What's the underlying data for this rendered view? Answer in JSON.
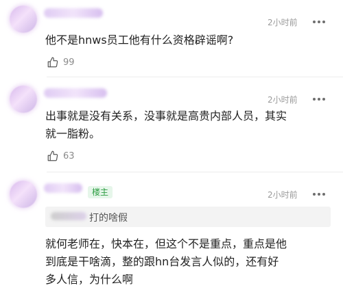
{
  "comments": [
    {
      "time": "2小时前",
      "text": "他不是hnws员工他有什么资格辟谣啊?",
      "likes": "99"
    },
    {
      "time": "2小时前",
      "text_line1": "出事就是没有关系，没事就是高贵内部人员，其实",
      "text_line2": "就一脂粉。",
      "likes": "63"
    },
    {
      "time": "2小时前",
      "badge": "楼主",
      "quote_text": "打的啥假",
      "text_line1": "就何老师在，快本在，但这个不是重点，重点是他",
      "text_line2": "到底是干啥滴，整的跟hn台发言人似的，还有好",
      "text_line3": "多人信，为什么啊"
    }
  ],
  "icons": {
    "like": "thumbs-up-icon",
    "more": "more-dots-icon"
  }
}
